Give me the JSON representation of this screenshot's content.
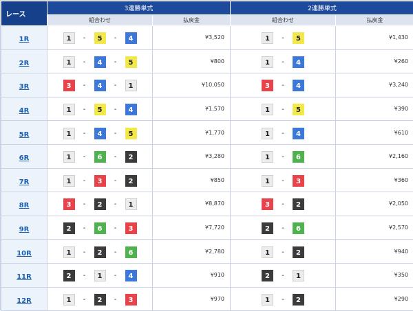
{
  "header": {
    "race_label": "レース",
    "trifecta_label": "3連勝単式",
    "exacta_label": "2連勝単式",
    "combo_label": "組合わせ",
    "payout_label": "払戻金",
    "dash": "-"
  },
  "boat_colors": {
    "1": "#ececec",
    "2": "#3b3b3b",
    "3": "#e8434a",
    "4": "#3b78d8",
    "5": "#f3e84a",
    "6": "#4fb24f"
  },
  "rows": [
    {
      "race": "1R",
      "tri": [
        "1",
        "5",
        "4"
      ],
      "tri_pay": "¥3,520",
      "ex": [
        "1",
        "5"
      ],
      "ex_pay": "¥1,430"
    },
    {
      "race": "2R",
      "tri": [
        "1",
        "4",
        "5"
      ],
      "tri_pay": "¥800",
      "ex": [
        "1",
        "4"
      ],
      "ex_pay": "¥260"
    },
    {
      "race": "3R",
      "tri": [
        "3",
        "4",
        "1"
      ],
      "tri_pay": "¥10,050",
      "ex": [
        "3",
        "4"
      ],
      "ex_pay": "¥3,240"
    },
    {
      "race": "4R",
      "tri": [
        "1",
        "5",
        "4"
      ],
      "tri_pay": "¥1,570",
      "ex": [
        "1",
        "5"
      ],
      "ex_pay": "¥390"
    },
    {
      "race": "5R",
      "tri": [
        "1",
        "4",
        "5"
      ],
      "tri_pay": "¥1,770",
      "ex": [
        "1",
        "4"
      ],
      "ex_pay": "¥610"
    },
    {
      "race": "6R",
      "tri": [
        "1",
        "6",
        "2"
      ],
      "tri_pay": "¥3,280",
      "ex": [
        "1",
        "6"
      ],
      "ex_pay": "¥2,160"
    },
    {
      "race": "7R",
      "tri": [
        "1",
        "3",
        "2"
      ],
      "tri_pay": "¥850",
      "ex": [
        "1",
        "3"
      ],
      "ex_pay": "¥360"
    },
    {
      "race": "8R",
      "tri": [
        "3",
        "2",
        "1"
      ],
      "tri_pay": "¥8,870",
      "ex": [
        "3",
        "2"
      ],
      "ex_pay": "¥2,050"
    },
    {
      "race": "9R",
      "tri": [
        "2",
        "6",
        "3"
      ],
      "tri_pay": "¥7,720",
      "ex": [
        "2",
        "6"
      ],
      "ex_pay": "¥2,570"
    },
    {
      "race": "10R",
      "tri": [
        "1",
        "2",
        "6"
      ],
      "tri_pay": "¥2,780",
      "ex": [
        "1",
        "2"
      ],
      "ex_pay": "¥940"
    },
    {
      "race": "11R",
      "tri": [
        "2",
        "1",
        "4"
      ],
      "tri_pay": "¥910",
      "ex": [
        "2",
        "1"
      ],
      "ex_pay": "¥350"
    },
    {
      "race": "12R",
      "tri": [
        "1",
        "2",
        "3"
      ],
      "tri_pay": "¥970",
      "ex": [
        "1",
        "2"
      ],
      "ex_pay": "¥290"
    }
  ]
}
